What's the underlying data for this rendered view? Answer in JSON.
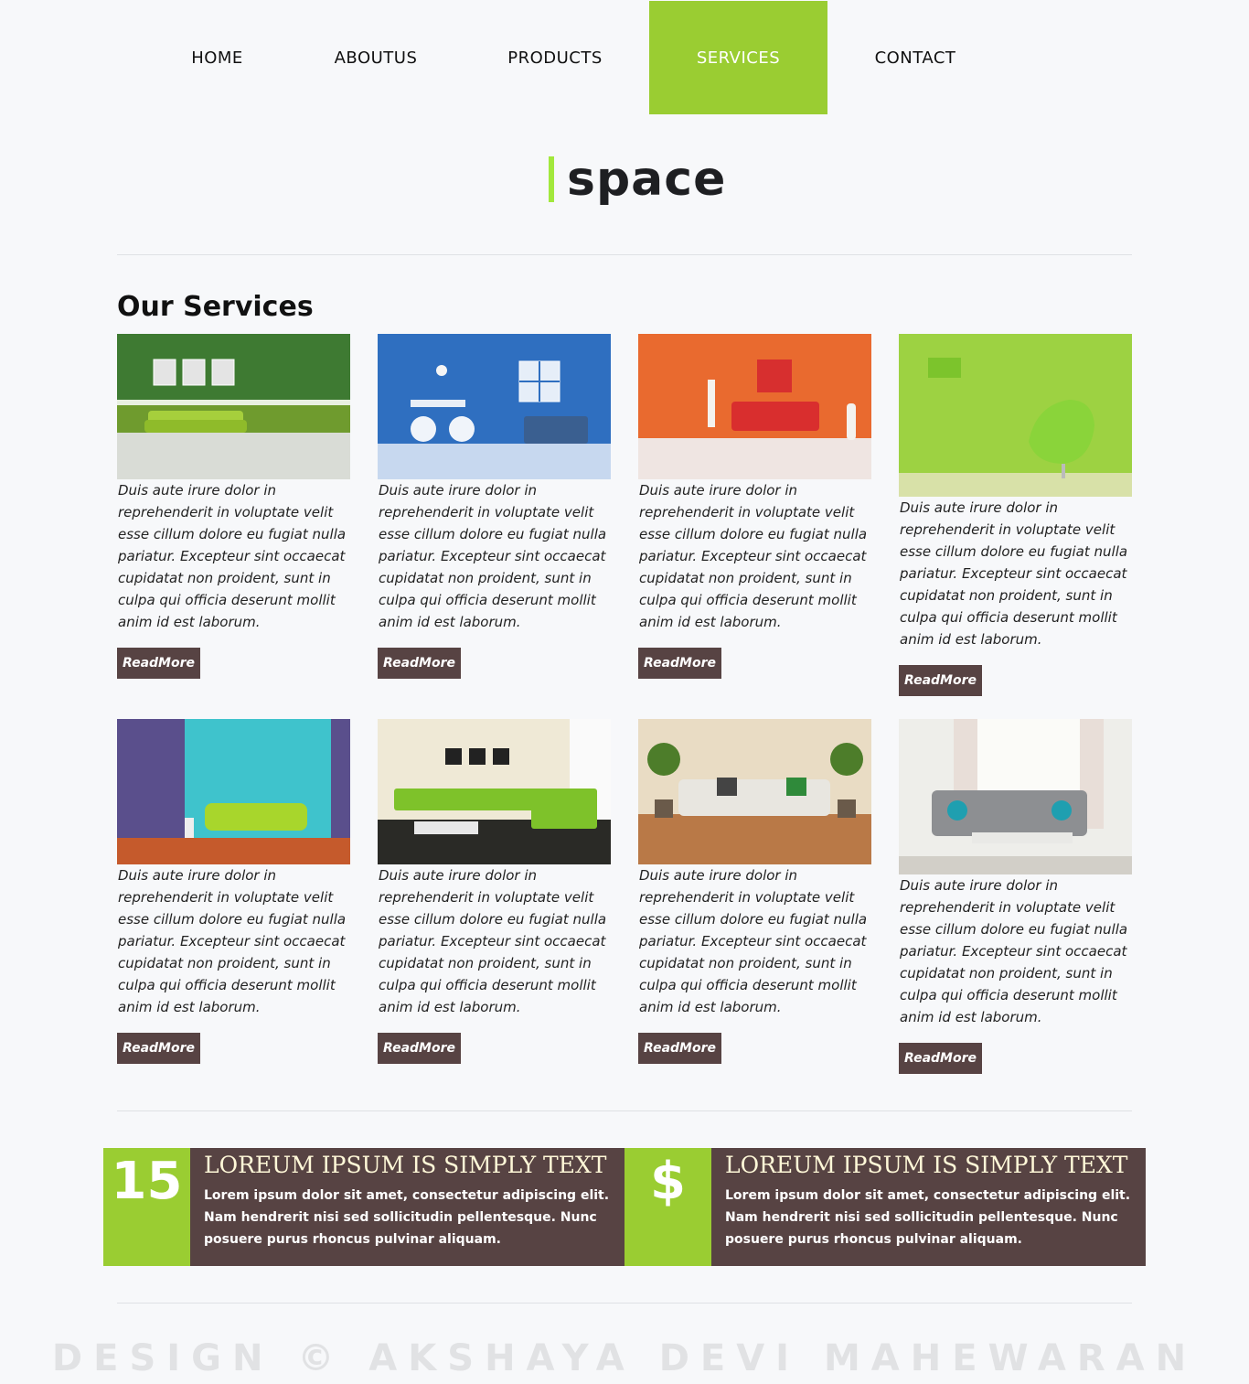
{
  "nav": {
    "items": [
      {
        "label": "HOME"
      },
      {
        "label": "ABOUTUS"
      },
      {
        "label": "PRODUCTS"
      },
      {
        "label": "SERVICES"
      },
      {
        "label": "CONTACT"
      }
    ],
    "active": "SERVICES",
    "accent_color": "#9acd32"
  },
  "logo": {
    "text": "space",
    "bar_color": "#a2e83c"
  },
  "services": {
    "title": "Our Services",
    "cards": [
      {
        "image": "green-room-sofa-image",
        "text": "Duis aute irure dolor in reprehenderit in voluptate velit esse cillum dolore eu fugiat nulla pariatur. Excepteur sint occaecat cupidatat non proident, sunt in culpa qui officia deserunt mollit anim id est laborum.",
        "button": "ReadMore"
      },
      {
        "image": "blue-room-dining-image",
        "text": "Duis aute irure dolor in reprehenderit in voluptate velit esse cillum dolore eu fugiat nulla pariatur. Excepteur sint occaecat cupidatat non proident, sunt in culpa qui officia deserunt mollit anim id est laborum.",
        "button": "ReadMore"
      },
      {
        "image": "orange-room-red-sofa-image",
        "text": "Duis aute irure dolor in reprehenderit in voluptate velit esse cillum dolore eu fugiat nulla pariatur. Excepteur sint occaecat cupidatat non proident, sunt in culpa qui officia deserunt mollit anim id est laborum.",
        "button": "ReadMore"
      },
      {
        "image": "lime-room-chair-image",
        "text": "Duis aute irure dolor in reprehenderit in voluptate velit esse cillum dolore eu fugiat nulla pariatur. Excepteur sint occaecat cupidatat non proident, sunt in culpa qui officia deserunt mollit anim id est laborum.",
        "button": "ReadMore"
      },
      {
        "image": "teal-purple-room-image",
        "text": "Duis aute irure dolor in reprehenderit in voluptate velit esse cillum dolore eu fugiat nulla pariatur. Excepteur sint occaecat cupidatat non proident, sunt in culpa qui officia deserunt mollit anim id est laborum.",
        "button": "ReadMore"
      },
      {
        "image": "green-sectional-living-image",
        "text": "Duis aute irure dolor in reprehenderit in voluptate velit esse cillum dolore eu fugiat nulla pariatur. Excepteur sint occaecat cupidatat non proident, sunt in culpa qui officia deserunt mollit anim id est laborum.",
        "button": "ReadMore"
      },
      {
        "image": "beige-room-plants-image",
        "text": "Duis aute irure dolor in reprehenderit in voluptate velit esse cillum dolore eu fugiat nulla pariatur. Excepteur sint occaecat cupidatat non proident, sunt in culpa qui officia deserunt mollit anim id est laborum.",
        "button": "ReadMore"
      },
      {
        "image": "grey-sofa-window-image",
        "text": "Duis aute irure dolor in reprehenderit in voluptate velit esse cillum dolore eu fugiat nulla pariatur. Excepteur sint occaecat cupidatat non proident, sunt in culpa qui officia deserunt mollit anim id est laborum.",
        "button": "ReadMore"
      }
    ]
  },
  "features": [
    {
      "badge": "15",
      "title": "LOREUM IPSUM IS SIMPLY TEXT",
      "text": "Lorem ipsum dolor sit amet, consectetur adipiscing elit. Nam hendrerit nisi sed sollicitudin pellentesque. Nunc posuere purus rhoncus pulvinar aliquam."
    },
    {
      "badge": "$",
      "title": "LOREUM IPSUM IS SIMPLY TEXT",
      "text": "Lorem ipsum dolor sit amet, consectetur adipiscing elit. Nam hendrerit nisi sed sollicitudin pellentesque. Nunc posuere purus rhoncus pulvinar aliquam."
    }
  ],
  "footer": {
    "text": "DESIGN © AKSHAYA DEVI MAHEWARAN"
  },
  "colors": {
    "brown": "#574343",
    "green": "#9acd32",
    "background": "#f7f8fa"
  }
}
